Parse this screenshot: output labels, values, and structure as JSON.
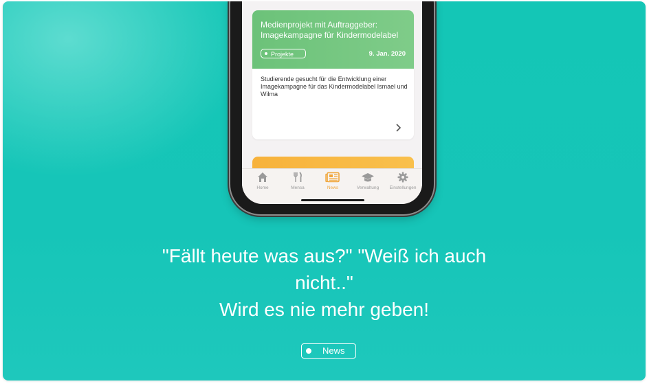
{
  "news_card": {
    "title": "Medienprojekt mit Auftraggeber: Imagekampagne für Kindermodelabel",
    "tag": "Projekte",
    "date": "9. Jan. 2020",
    "body": "Studierende gesucht für die Entwicklung einer Imagekampagne für das Kindermodelabel Ismael und Wilma"
  },
  "tabbar": {
    "items": [
      {
        "label": "Home",
        "icon": "home-icon"
      },
      {
        "label": "Mensa",
        "icon": "cutlery-icon"
      },
      {
        "label": "News",
        "icon": "newspaper-icon"
      },
      {
        "label": "Verwaltung",
        "icon": "graduation-cap-icon"
      },
      {
        "label": "Einstellungen",
        "icon": "gear-icon"
      }
    ],
    "active_index": 2
  },
  "headline": {
    "line1": "\"Fällt heute was aus?\" \"Weiß ich auch",
    "line2": "nicht..\"",
    "line3": "Wird es nie mehr geben!"
  },
  "badge": {
    "label": "News"
  },
  "colors": {
    "background": "#16c5b8",
    "news_green": "#6cc279",
    "accent_orange": "#f0a63b"
  }
}
